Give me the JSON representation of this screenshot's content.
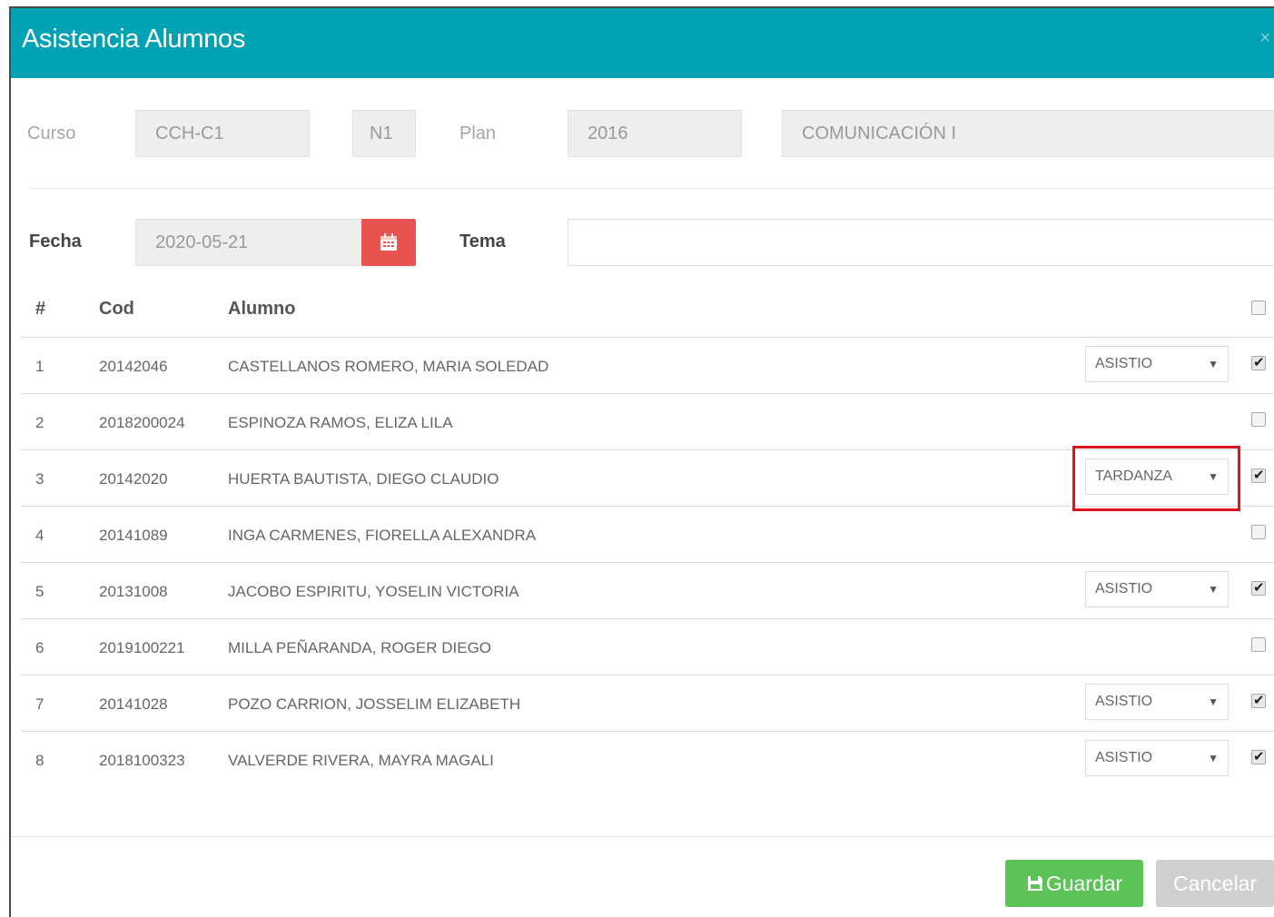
{
  "modal": {
    "title": "Asistencia Alumnos",
    "close": "×"
  },
  "course": {
    "curso_label": "Curso",
    "curso_value": "CCH-C1",
    "nivel_value": "N1",
    "plan_label": "Plan",
    "plan_value": "2016",
    "course_name": "COMUNICACIÓN I"
  },
  "session": {
    "fecha_label": "Fecha",
    "fecha_value": "2020-05-21",
    "tema_label": "Tema",
    "tema_value": ""
  },
  "table": {
    "headers": {
      "num": "#",
      "cod": "Cod",
      "alumno": "Alumno"
    },
    "rows": [
      {
        "num": "1",
        "cod": "20142046",
        "name": "CASTELLANOS ROMERO, MARIA SOLEDAD",
        "status": "ASISTIO",
        "checked": true
      },
      {
        "num": "2",
        "cod": "2018200024",
        "name": "ESPINOZA RAMOS, ELIZA LILA",
        "status": "",
        "checked": false
      },
      {
        "num": "3",
        "cod": "20142020",
        "name": "HUERTA BAUTISTA, DIEGO CLAUDIO",
        "status": "TARDANZA",
        "checked": true
      },
      {
        "num": "4",
        "cod": "20141089",
        "name": "INGA CARMENES, FIORELLA ALEXANDRA",
        "status": "",
        "checked": false
      },
      {
        "num": "5",
        "cod": "20131008",
        "name": "JACOBO ESPIRITU, YOSELIN VICTORIA",
        "status": "ASISTIO",
        "checked": true
      },
      {
        "num": "6",
        "cod": "2019100221",
        "name": "MILLA PEÑARANDA, ROGER DIEGO",
        "status": "",
        "checked": false
      },
      {
        "num": "7",
        "cod": "20141028",
        "name": "POZO CARRION, JOSSELIM ELIZABETH",
        "status": "ASISTIO",
        "checked": true
      },
      {
        "num": "8",
        "cod": "2018100323",
        "name": "VALVERDE RIVERA, MAYRA MAGALI",
        "status": "ASISTIO",
        "checked": true
      }
    ]
  },
  "footer": {
    "save_label": "Guardar",
    "cancel_label": "Cancelar"
  },
  "colors": {
    "header": "#00a3b4",
    "calendar_button": "#e8534f",
    "save_button": "#5cc456",
    "cancel_button": "#cfcfcf",
    "highlight": "#e0141c"
  },
  "icons": {
    "calendar": "calendar-icon",
    "save": "floppy-disk-icon",
    "close": "close-icon",
    "dropdown": "caret-down-icon"
  }
}
